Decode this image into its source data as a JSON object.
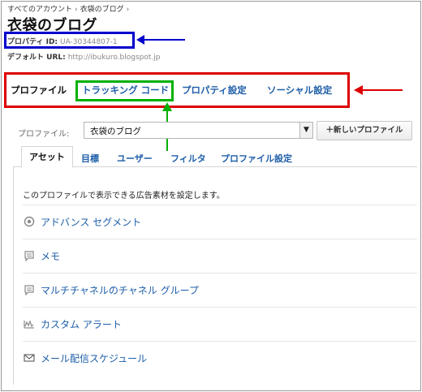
{
  "breadcrumb": [
    "すべてのアカウント",
    "衣袋のブログ"
  ],
  "page_title": "衣袋のブログ",
  "property": {
    "id_label": "プロパティ ID:",
    "id_value": "UA-30344807-1",
    "url_label": "デフォルト URL:",
    "url_value": "http://ibukuro.blogspot.jp"
  },
  "tabs": [
    {
      "label": "プロファイル",
      "active": true
    },
    {
      "label": "トラッキング コード",
      "active": false
    },
    {
      "label": "プロパティ設定",
      "active": false
    },
    {
      "label": "ソーシャル設定",
      "active": false
    }
  ],
  "profile": {
    "label": "プロファイル:",
    "selected": "衣袋のブログ",
    "new_button": "＋新しいプロファイル"
  },
  "subtabs": [
    {
      "label": "アセット",
      "active": true
    },
    {
      "label": "目標",
      "active": false
    },
    {
      "label": "ユーザー",
      "active": false
    },
    {
      "label": "フィルタ",
      "active": false
    },
    {
      "label": "プロファイル設定",
      "active": false
    }
  ],
  "panel": {
    "description": "このプロファイルで表示できる広告素材を設定します。",
    "items": [
      {
        "label": "アドバンス セグメント",
        "icon": "segment-icon"
      },
      {
        "label": "メモ",
        "icon": "memo-icon"
      },
      {
        "label": "マルチチャネルのチャネル グループ",
        "icon": "channel-group-icon"
      },
      {
        "label": "カスタム アラート",
        "icon": "alert-chart-icon"
      },
      {
        "label": "メール配信スケジュール",
        "icon": "mail-icon"
      }
    ]
  },
  "colors": {
    "annotation_blue": "#0000cc",
    "annotation_red": "#dd0000",
    "annotation_green": "#00b000",
    "link": "#1d5ea8"
  }
}
